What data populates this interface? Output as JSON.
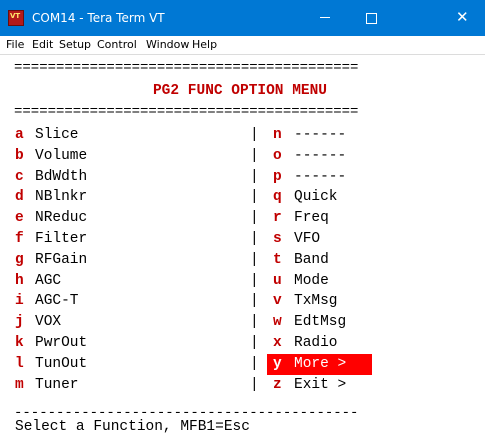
{
  "window": {
    "title": "COM14 - Tera Term VT",
    "icon": "VT",
    "min": "—",
    "max": "☐",
    "close": "✕"
  },
  "menu": [
    "File",
    "Edit",
    "Setup",
    "Control",
    "Window",
    "Help"
  ],
  "terminal": {
    "rule_double": "=========================================",
    "heading": "PG2 FUNC OPTION MENU",
    "rule_single": "-----------------------------------------",
    "separator": "|",
    "left": [
      {
        "key": "a",
        "label": "Slice"
      },
      {
        "key": "b",
        "label": "Volume"
      },
      {
        "key": "c",
        "label": "BdWdth"
      },
      {
        "key": "d",
        "label": "NBlnkr"
      },
      {
        "key": "e",
        "label": "NReduc"
      },
      {
        "key": "f",
        "label": "Filter"
      },
      {
        "key": "g",
        "label": "RFGain"
      },
      {
        "key": "h",
        "label": "AGC"
      },
      {
        "key": "i",
        "label": "AGC-T"
      },
      {
        "key": "j",
        "label": "VOX"
      },
      {
        "key": "k",
        "label": "PwrOut"
      },
      {
        "key": "l",
        "label": "TunOut"
      },
      {
        "key": "m",
        "label": "Tuner"
      }
    ],
    "right": [
      {
        "key": "n",
        "label": "------"
      },
      {
        "key": "o",
        "label": "------"
      },
      {
        "key": "p",
        "label": "------"
      },
      {
        "key": "q",
        "label": "Quick"
      },
      {
        "key": "r",
        "label": "Freq"
      },
      {
        "key": "s",
        "label": "VFO"
      },
      {
        "key": "t",
        "label": "Band"
      },
      {
        "key": "u",
        "label": "Mode"
      },
      {
        "key": "v",
        "label": "TxMsg"
      },
      {
        "key": "w",
        "label": "EdtMsg"
      },
      {
        "key": "x",
        "label": "Radio"
      },
      {
        "key": "y",
        "label": "More >"
      },
      {
        "key": "z",
        "label": "Exit >"
      }
    ],
    "prompt": "Select a Function, MFB1=Esc"
  }
}
